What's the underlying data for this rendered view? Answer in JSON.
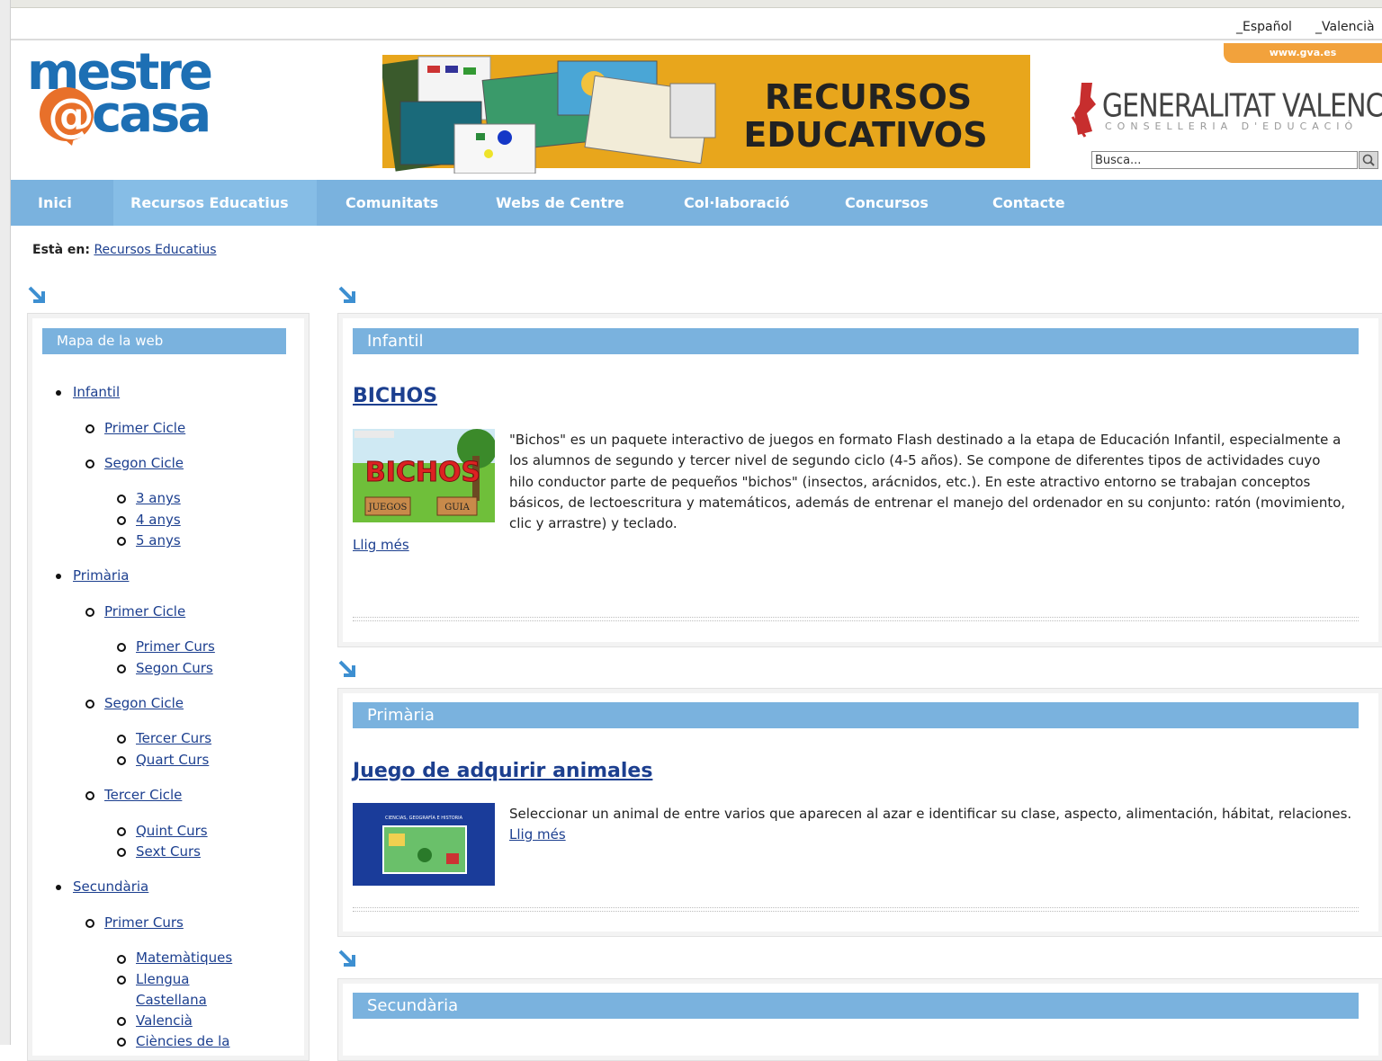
{
  "lang": {
    "es": "_Español",
    "va": "_Valencià"
  },
  "header": {
    "logo_line1": "mestre",
    "logo_at": "@",
    "logo_line2": "casa",
    "banner_line1": "RECURSOS",
    "banner_line2": "EDUCATIVOS",
    "gva_link": "www.gva.es",
    "gva_name": "GENERALITAT VALENCIANA",
    "gva_sub": "CONSELLERIA D'EDUCACIÓ",
    "search_value": "Busca..."
  },
  "nav": {
    "items": [
      "Inici",
      "Recursos Educatius",
      "Comunitats",
      "Webs de Centre",
      "Col·laboració",
      "Concursos",
      "Contacte"
    ],
    "active_index": 1
  },
  "breadcrumb": {
    "label": "Està en:",
    "link": "Recursos Educatius"
  },
  "sidebar": {
    "title": "Mapa de la web",
    "infantil": "Infantil",
    "inf_primer": "Primer Cicle",
    "inf_segon": "Segon Cicle",
    "anys3": "3 anys",
    "anys4": "4 anys",
    "anys5": "5 anys",
    "primaria": "Primària",
    "pri_primer": "Primer Cicle",
    "primer_curs": "Primer Curs",
    "segon_curs": "Segon Curs",
    "pri_segon": "Segon Cicle",
    "tercer_curs": "Tercer Curs",
    "quart_curs": "Quart Curs",
    "pri_tercer": "Tercer Cicle",
    "quint_curs": "Quint Curs",
    "sext_curs": "Sext Curs",
    "secundaria": "Secundària",
    "sec_primer": "Primer Curs",
    "matematiques": "Matemàtiques",
    "llengua1": "Llengua",
    "llengua2": "Castellana",
    "valencia": "Valencià",
    "ciencies": "Ciències de la"
  },
  "sections": {
    "infantil": {
      "heading": "Infantil",
      "title": "BICHOS",
      "thumb_text": "BICHOS",
      "thumb_btn1": "JUEGOS",
      "thumb_btn2": "GUIA",
      "desc1": "\"Bichos\" es un paquete interactivo de juegos en formato Flash destinado a la etapa de Educación Infantil, especialmente a",
      "desc2": "los alumnos de segundo y tercer nivel de segundo ciclo (4-5 años). Se compone de diferentes tipos de actividades cuyo",
      "desc3": "hilo conductor parte de pequeños \"bichos\" (insectos, arácnidos, etc.). En este atractivo entorno se trabajan conceptos",
      "desc4": "básicos, de lectoescritura y matemáticos, además de entrenar el manejo del ordenador en su conjunto: ratón (movimiento,",
      "desc5": "clic y arrastre) y teclado.",
      "more": "Llig més"
    },
    "primaria": {
      "heading": "Primària",
      "title": "Juego de adquirir animales",
      "thumb_text": "CIENCIAS, GEOGRAFÍA E HISTORIA",
      "desc1": "Seleccionar un animal de entre varios que aparecen al azar e identificar su clase, aspecto, alimentación, hábitat, relaciones.",
      "more": "Llig més"
    },
    "secundaria": {
      "heading": "Secundària"
    }
  },
  "colors": {
    "nav_blue": "#7ab2de",
    "link_blue": "#1c3f8f",
    "orange": "#f2a23c"
  }
}
